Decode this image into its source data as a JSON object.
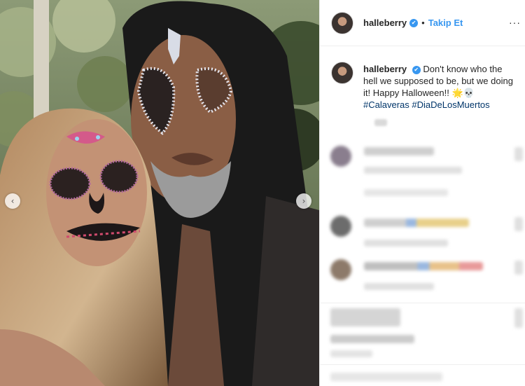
{
  "post": {
    "username": "halleberry",
    "verified_mark": "✔",
    "follow_separator": "•",
    "follow_label": "Takip Et",
    "more_label": "···",
    "caption": {
      "username": "halleberry",
      "text": "Don't know who the hell we supposed to be, but we doing it! Happy Halloween!! ",
      "emoji": "🌟💀",
      "hashtags": [
        "#Calaveras",
        "#DiaDeLosMuertos"
      ]
    }
  },
  "carousel": {
    "prev_icon": "‹",
    "next_icon": "›"
  },
  "colors": {
    "accent": "#3897f0",
    "hashtag": "#003569",
    "border": "#efefef"
  }
}
